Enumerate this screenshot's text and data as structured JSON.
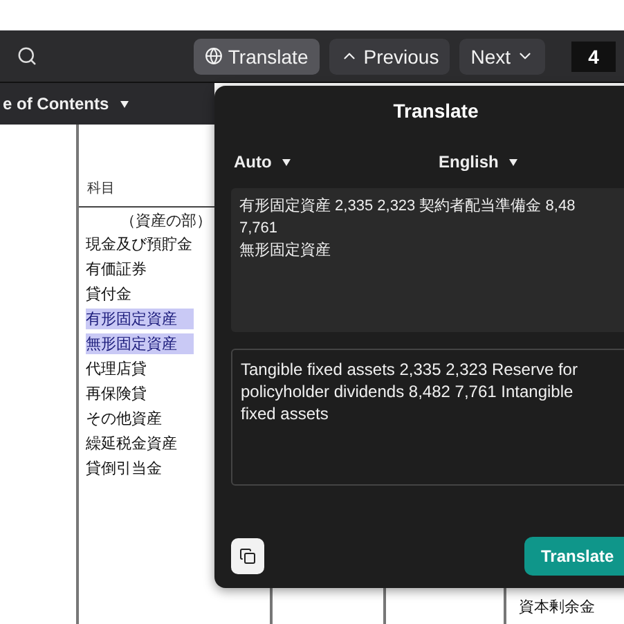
{
  "toolbar": {
    "buttons": [
      {
        "kind": "translate",
        "label": "Translate",
        "selected": true
      },
      {
        "kind": "previous",
        "label": "Previous",
        "selected": false
      },
      {
        "kind": "next",
        "label": "Next",
        "selected": false
      }
    ],
    "page": "4"
  },
  "sidebar": {
    "title": "e of Contents"
  },
  "document": {
    "column_header": "科目",
    "section": "（資産の部）",
    "rows": [
      {
        "text": "現金及び預貯金",
        "highlighted": false
      },
      {
        "text": "有価証券",
        "highlighted": false
      },
      {
        "text": "貸付金",
        "highlighted": false
      },
      {
        "text": "有形固定資産",
        "highlighted": true
      },
      {
        "text": "無形固定資産",
        "highlighted": true
      },
      {
        "text": "代理店貸",
        "highlighted": false
      },
      {
        "text": "再保険貸",
        "highlighted": false
      },
      {
        "text": "その他資産",
        "highlighted": false
      },
      {
        "text": "繰延税金資産",
        "highlighted": false
      },
      {
        "text": "貸倒引当金",
        "highlighted": false
      }
    ],
    "lower_text": "資本剰余金"
  },
  "translate_dialog": {
    "title": "Translate",
    "source_language": "Auto",
    "target_language": "English",
    "source_lines": [
      "有形固定資産 2,335 2,323 契約者配当準備金 8,48",
      "7,761",
      "無形固定資産"
    ],
    "translated_text": "Tangible fixed assets 2,335 2,323 Reserve for policyholder dividends 8,482 7,761 Intangible fixed assets",
    "button": "Translate"
  }
}
